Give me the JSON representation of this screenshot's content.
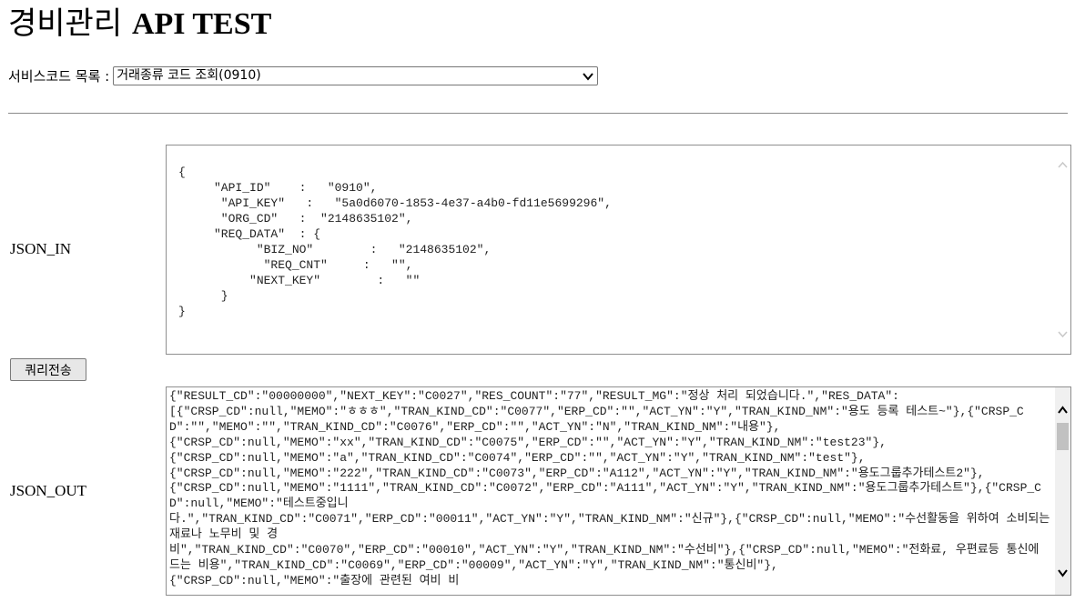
{
  "header": {
    "title_ko": "경비관리",
    "title_en": "API TEST"
  },
  "service": {
    "label": "서비스코드 목록 :",
    "selected": "거래종류 코드 조회(0910)"
  },
  "json_in": {
    "label": "JSON_IN",
    "value": "{\n     \"API_ID\"    :   \"0910\",\n      \"API_KEY\"   :   \"5a0d6070-1853-4e37-a4b0-fd11e5699296\",\n      \"ORG_CD\"   :  \"2148635102\",\n     \"REQ_DATA\"  : {\n           \"BIZ_NO\"        :   \"2148635102\",\n            \"REQ_CNT\"     :   \"\",\n          \"NEXT_KEY\"        :   \"\"\n      }\n}"
  },
  "send_button": {
    "label": "쿼리전송"
  },
  "json_out": {
    "label": "JSON_OUT",
    "value": "{\"RESULT_CD\":\"00000000\",\"NEXT_KEY\":\"C0027\",\"RES_COUNT\":\"77\",\"RESULT_MG\":\"정상 처리 되었습니다.\",\"RES_DATA\":\n[{\"CRSP_CD\":null,\"MEMO\":\"ㅎㅎㅎ\",\"TRAN_KIND_CD\":\"C0077\",\"ERP_CD\":\"\",\"ACT_YN\":\"Y\",\"TRAN_KIND_NM\":\"용도 등록 테스트~\"},{\"CRSP_CD\":\"\",\"MEMO\":\"\",\"TRAN_KIND_CD\":\"C0076\",\"ERP_CD\":\"\",\"ACT_YN\":\"N\",\"TRAN_KIND_NM\":\"내용\"},\n{\"CRSP_CD\":null,\"MEMO\":\"xx\",\"TRAN_KIND_CD\":\"C0075\",\"ERP_CD\":\"\",\"ACT_YN\":\"Y\",\"TRAN_KIND_NM\":\"test23\"},\n{\"CRSP_CD\":null,\"MEMO\":\"a\",\"TRAN_KIND_CD\":\"C0074\",\"ERP_CD\":\"\",\"ACT_YN\":\"Y\",\"TRAN_KIND_NM\":\"test\"},\n{\"CRSP_CD\":null,\"MEMO\":\"222\",\"TRAN_KIND_CD\":\"C0073\",\"ERP_CD\":\"A112\",\"ACT_YN\":\"Y\",\"TRAN_KIND_NM\":\"용도그룹추가테스트2\"},\n{\"CRSP_CD\":null,\"MEMO\":\"1111\",\"TRAN_KIND_CD\":\"C0072\",\"ERP_CD\":\"A111\",\"ACT_YN\":\"Y\",\"TRAN_KIND_NM\":\"용도그룹추가테스트\"},{\"CRSP_CD\":null,\"MEMO\":\"테스트중입니\n다.\",\"TRAN_KIND_CD\":\"C0071\",\"ERP_CD\":\"00011\",\"ACT_YN\":\"Y\",\"TRAN_KIND_NM\":\"신규\"},{\"CRSP_CD\":null,\"MEMO\":\"수선활동을 위하여 소비되는 재료나 노무비 및 경\n비\",\"TRAN_KIND_CD\":\"C0070\",\"ERP_CD\":\"00010\",\"ACT_YN\":\"Y\",\"TRAN_KIND_NM\":\"수선비\"},{\"CRSP_CD\":null,\"MEMO\":\"전화료, 우편료등 통신에 드는 비용\",\"TRAN_KIND_CD\":\"C0069\",\"ERP_CD\":\"00009\",\"ACT_YN\":\"Y\",\"TRAN_KIND_NM\":\"통신비\"},\n{\"CRSP_CD\":null,\"MEMO\":\"출장에 관련된 여비 비"
  }
}
